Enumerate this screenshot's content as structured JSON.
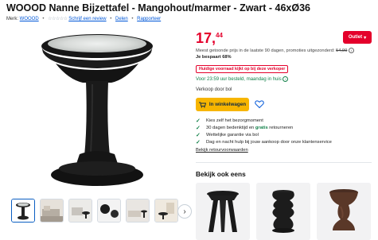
{
  "product": {
    "title": "WOOOD Nanne Bijzettafel - Mangohout/marmer - Zwart - 46xØ36"
  },
  "meta": {
    "brand_prefix": "Merk:",
    "brand": "WOOOD",
    "review_link": "Schrijf een review",
    "share": "Delen",
    "report": "Rapporteer"
  },
  "price": {
    "whole": "17,",
    "cents": "44",
    "outlet_label": "Outlet",
    "compare_text": "Meest getoonde prijs in de laatste 90 dagen, promoties uitgezonderd:",
    "compare_price": "54,99",
    "savings": "Je bespaart 68%",
    "promo_badge": "Huidige voorraad kijkt op bij deze verkoper",
    "delivery": "Voor 23:59 uur besteld, maandag in huis"
  },
  "seller": {
    "label": "Verkoop door bol"
  },
  "cart": {
    "button_label": "In winkelwagen"
  },
  "usps": [
    {
      "text": "Kies zelf het bezorgmoment"
    },
    {
      "pre": "30 dagen bedenktijd en ",
      "bold": "gratis",
      "post": " retourneren"
    },
    {
      "text": "Wettelijke garantie via bol"
    },
    {
      "text": "Dag en nacht hulp bij jouw aankoop door onze klantenservice"
    }
  ],
  "returns_link": "Bekijk retourvoorwaarden",
  "recommendations": {
    "heading": "Bekijk ook eens"
  },
  "colors": {
    "price_red": "#e4002b",
    "cart_yellow": "#f7b500",
    "link_blue": "#0057d8",
    "green": "#14824b"
  },
  "icons": [
    "cart-icon",
    "heart-icon",
    "check-icon",
    "chevron-right-icon",
    "chevron-down-icon",
    "info-icon"
  ]
}
